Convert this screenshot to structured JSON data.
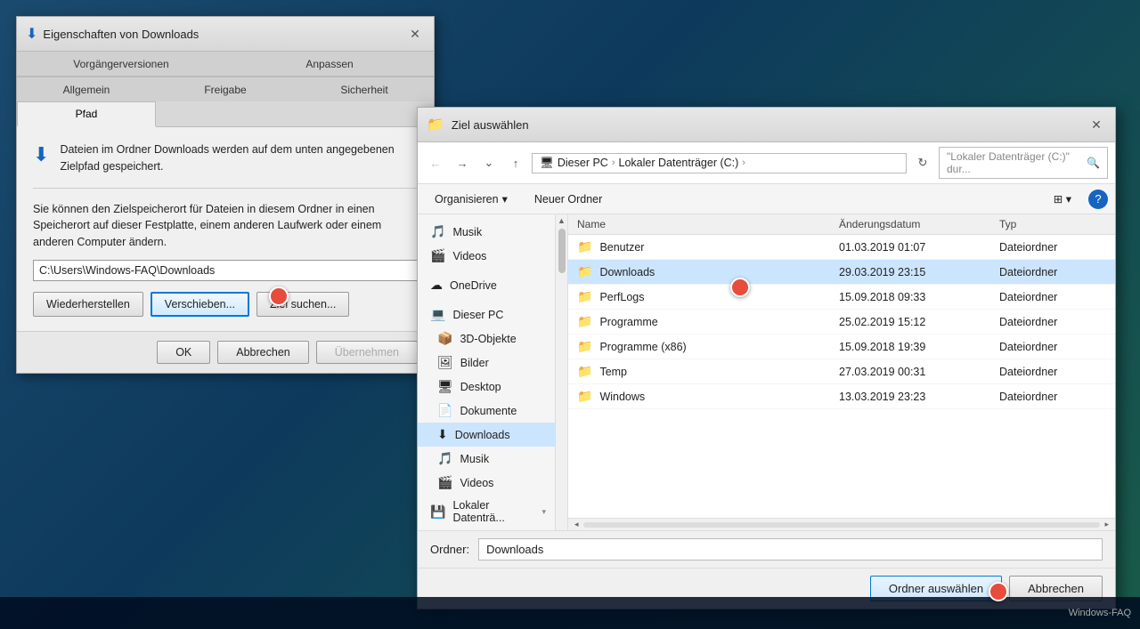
{
  "properties_dialog": {
    "title": "Eigenschaften von Downloads",
    "tabs_row1": [
      "Vorgängerversionen",
      "Anpassen"
    ],
    "tabs_row2": [
      "Allgemein",
      "Freigabe",
      "Sicherheit",
      "Pfad"
    ],
    "active_tab": "Pfad",
    "info_text": "Dateien im Ordner Downloads werden auf dem unten angegebenen Zielpfad gespeichert.",
    "path_description": "Sie können den Zielspeicherort für Dateien in diesem Ordner in einen Speicherort auf dieser Festplatte, einem anderen Laufwerk oder einem anderen Computer ändern.",
    "path_value": "C:\\Users\\Windows-FAQ\\Downloads",
    "btn_restore": "Wiederherstellen",
    "btn_move": "Verschieben...",
    "btn_find": "Ziel suchen...",
    "btn_ok": "OK",
    "btn_cancel": "Abbrechen",
    "btn_apply": "Übernehmen"
  },
  "folder_dialog": {
    "title": "Ziel auswählen",
    "breadcrumb": {
      "pc": "Dieser PC",
      "drive": "Lokaler Datenträger (C:)",
      "sep": "›"
    },
    "search_placeholder": "\"Lokaler Datenträger (C:)\" dur...",
    "toolbar": {
      "organize": "Organisieren",
      "new_folder": "Neuer Ordner"
    },
    "sidebar_items": [
      {
        "label": "Musik",
        "icon": "🎵"
      },
      {
        "label": "Videos",
        "icon": "🎬"
      },
      {
        "label": "OneDrive",
        "icon": "☁"
      },
      {
        "label": "Dieser PC",
        "icon": "💻"
      },
      {
        "label": "3D-Objekte",
        "icon": "📦"
      },
      {
        "label": "Bilder",
        "icon": "🖼"
      },
      {
        "label": "Desktop",
        "icon": "🖥"
      },
      {
        "label": "Dokumente",
        "icon": "📄"
      },
      {
        "label": "Downloads",
        "icon": "⬇"
      },
      {
        "label": "Musik",
        "icon": "🎵"
      },
      {
        "label": "Videos",
        "icon": "🎬"
      },
      {
        "label": "Lokaler Datenträ...",
        "icon": "💾"
      }
    ],
    "columns": {
      "name": "Name",
      "date": "Änderungsdatum",
      "type": "Typ"
    },
    "files": [
      {
        "name": "Benutzer",
        "date": "01.03.2019 01:07",
        "type": "Dateiordner",
        "selected": false
      },
      {
        "name": "Downloads",
        "date": "29.03.2019 23:15",
        "type": "Dateiordner",
        "selected": true
      },
      {
        "name": "PerfLogs",
        "date": "15.09.2018 09:33",
        "type": "Dateiordner",
        "selected": false
      },
      {
        "name": "Programme",
        "date": "25.02.2019 15:12",
        "type": "Dateiordner",
        "selected": false
      },
      {
        "name": "Programme (x86)",
        "date": "15.09.2018 19:39",
        "type": "Dateiordner",
        "selected": false
      },
      {
        "name": "Temp",
        "date": "27.03.2019 00:31",
        "type": "Dateiordner",
        "selected": false
      },
      {
        "name": "Windows",
        "date": "13.03.2019 23:23",
        "type": "Dateiordner",
        "selected": false
      }
    ],
    "folder_label": "Ordner:",
    "folder_value": "Downloads",
    "btn_select": "Ordner auswählen",
    "btn_cancel": "Abbrechen"
  },
  "taskbar": {
    "label": "Windows-FAQ"
  }
}
